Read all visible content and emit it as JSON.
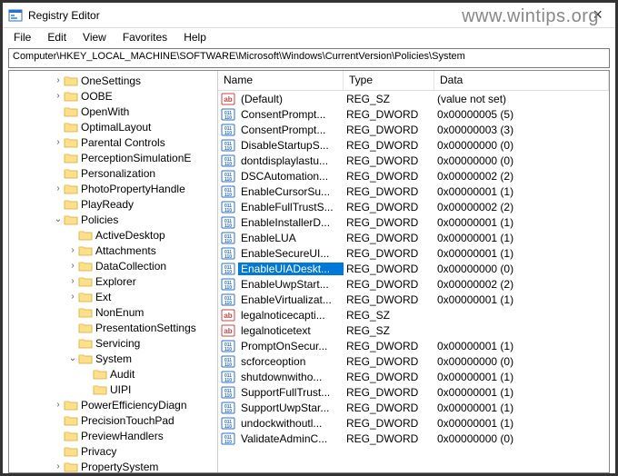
{
  "watermark": "www.wintips.org",
  "window": {
    "title": "Registry Editor"
  },
  "menu": {
    "file": "File",
    "edit": "Edit",
    "view": "View",
    "favorites": "Favorites",
    "help": "Help"
  },
  "address": "Computer\\HKEY_LOCAL_MACHINE\\SOFTWARE\\Microsoft\\Windows\\CurrentVersion\\Policies\\System",
  "columns": {
    "name": "Name",
    "type": "Type",
    "data": "Data"
  },
  "tree": [
    {
      "depth": 0,
      "exp": "collapsed",
      "label": "OneSettings"
    },
    {
      "depth": 0,
      "exp": "collapsed",
      "label": "OOBE"
    },
    {
      "depth": 0,
      "exp": "none",
      "label": "OpenWith"
    },
    {
      "depth": 0,
      "exp": "none",
      "label": "OptimalLayout"
    },
    {
      "depth": 0,
      "exp": "collapsed",
      "label": "Parental Controls"
    },
    {
      "depth": 0,
      "exp": "none",
      "label": "PerceptionSimulationE"
    },
    {
      "depth": 0,
      "exp": "none",
      "label": "Personalization"
    },
    {
      "depth": 0,
      "exp": "collapsed",
      "label": "PhotoPropertyHandle"
    },
    {
      "depth": 0,
      "exp": "none",
      "label": "PlayReady"
    },
    {
      "depth": 0,
      "exp": "expanded",
      "label": "Policies"
    },
    {
      "depth": 1,
      "exp": "none",
      "label": "ActiveDesktop"
    },
    {
      "depth": 1,
      "exp": "collapsed",
      "label": "Attachments"
    },
    {
      "depth": 1,
      "exp": "collapsed",
      "label": "DataCollection"
    },
    {
      "depth": 1,
      "exp": "collapsed",
      "label": "Explorer"
    },
    {
      "depth": 1,
      "exp": "collapsed",
      "label": "Ext"
    },
    {
      "depth": 1,
      "exp": "none",
      "label": "NonEnum"
    },
    {
      "depth": 1,
      "exp": "none",
      "label": "PresentationSettings"
    },
    {
      "depth": 1,
      "exp": "none",
      "label": "Servicing"
    },
    {
      "depth": 1,
      "exp": "expanded",
      "label": "System"
    },
    {
      "depth": 2,
      "exp": "none",
      "label": "Audit"
    },
    {
      "depth": 2,
      "exp": "none",
      "label": "UIPI"
    },
    {
      "depth": 0,
      "exp": "collapsed",
      "label": "PowerEfficiencyDiagn"
    },
    {
      "depth": 0,
      "exp": "none",
      "label": "PrecisionTouchPad"
    },
    {
      "depth": 0,
      "exp": "none",
      "label": "PreviewHandlers"
    },
    {
      "depth": 0,
      "exp": "none",
      "label": "Privacy"
    },
    {
      "depth": 0,
      "exp": "collapsed",
      "label": "PropertySystem"
    }
  ],
  "values": [
    {
      "icon": "sz",
      "name": "(Default)",
      "type": "REG_SZ",
      "data": "(value not set)",
      "selected": false
    },
    {
      "icon": "dw",
      "name": "ConsentPrompt...",
      "type": "REG_DWORD",
      "data": "0x00000005 (5)",
      "selected": false
    },
    {
      "icon": "dw",
      "name": "ConsentPrompt...",
      "type": "REG_DWORD",
      "data": "0x00000003 (3)",
      "selected": false
    },
    {
      "icon": "dw",
      "name": "DisableStartupS...",
      "type": "REG_DWORD",
      "data": "0x00000000 (0)",
      "selected": false
    },
    {
      "icon": "dw",
      "name": "dontdisplaylastu...",
      "type": "REG_DWORD",
      "data": "0x00000000 (0)",
      "selected": false
    },
    {
      "icon": "dw",
      "name": "DSCAutomation...",
      "type": "REG_DWORD",
      "data": "0x00000002 (2)",
      "selected": false
    },
    {
      "icon": "dw",
      "name": "EnableCursorSu...",
      "type": "REG_DWORD",
      "data": "0x00000001 (1)",
      "selected": false
    },
    {
      "icon": "dw",
      "name": "EnableFullTrustS...",
      "type": "REG_DWORD",
      "data": "0x00000002 (2)",
      "selected": false
    },
    {
      "icon": "dw",
      "name": "EnableInstallerD...",
      "type": "REG_DWORD",
      "data": "0x00000001 (1)",
      "selected": false
    },
    {
      "icon": "dw",
      "name": "EnableLUA",
      "type": "REG_DWORD",
      "data": "0x00000001 (1)",
      "selected": false
    },
    {
      "icon": "dw",
      "name": "EnableSecureUI...",
      "type": "REG_DWORD",
      "data": "0x00000001 (1)",
      "selected": false
    },
    {
      "icon": "dw",
      "name": "EnableUIADeskt...",
      "type": "REG_DWORD",
      "data": "0x00000000 (0)",
      "selected": true
    },
    {
      "icon": "dw",
      "name": "EnableUwpStart...",
      "type": "REG_DWORD",
      "data": "0x00000002 (2)",
      "selected": false
    },
    {
      "icon": "dw",
      "name": "EnableVirtualizat...",
      "type": "REG_DWORD",
      "data": "0x00000001 (1)",
      "selected": false
    },
    {
      "icon": "sz",
      "name": "legalnoticecapti...",
      "type": "REG_SZ",
      "data": "",
      "selected": false
    },
    {
      "icon": "sz",
      "name": "legalnoticetext",
      "type": "REG_SZ",
      "data": "",
      "selected": false
    },
    {
      "icon": "dw",
      "name": "PromptOnSecur...",
      "type": "REG_DWORD",
      "data": "0x00000001 (1)",
      "selected": false
    },
    {
      "icon": "dw",
      "name": "scforceoption",
      "type": "REG_DWORD",
      "data": "0x00000000 (0)",
      "selected": false
    },
    {
      "icon": "dw",
      "name": "shutdownwitho...",
      "type": "REG_DWORD",
      "data": "0x00000001 (1)",
      "selected": false
    },
    {
      "icon": "dw",
      "name": "SupportFullTrust...",
      "type": "REG_DWORD",
      "data": "0x00000001 (1)",
      "selected": false
    },
    {
      "icon": "dw",
      "name": "SupportUwpStar...",
      "type": "REG_DWORD",
      "data": "0x00000001 (1)",
      "selected": false
    },
    {
      "icon": "dw",
      "name": "undockwithoutl...",
      "type": "REG_DWORD",
      "data": "0x00000001 (1)",
      "selected": false
    },
    {
      "icon": "dw",
      "name": "ValidateAdminC...",
      "type": "REG_DWORD",
      "data": "0x00000000 (0)",
      "selected": false
    }
  ]
}
